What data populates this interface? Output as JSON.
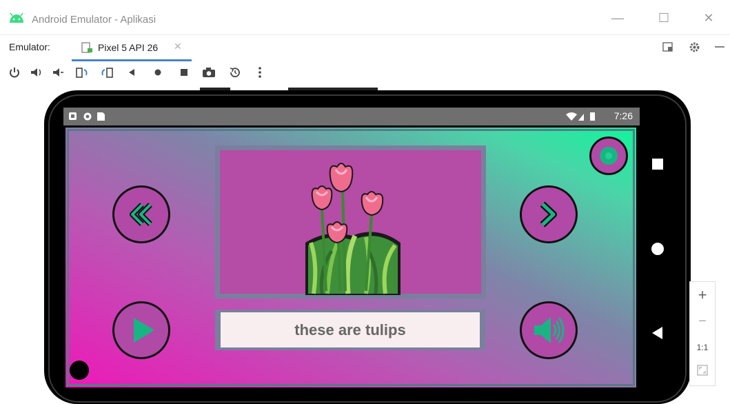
{
  "window": {
    "title": "Android Emulator - Aplikasi",
    "minimize": "—",
    "maximize": "☐",
    "close": "✕"
  },
  "tabs": {
    "label": "Emulator:",
    "device": "Pixel 5 API 26",
    "close": "✕"
  },
  "toolbar_icons": [
    "power-icon",
    "volume-up-icon",
    "volume-down-icon",
    "rotate-left-icon",
    "rotate-right-icon",
    "back-icon",
    "home-icon",
    "overview-icon",
    "screenshot-icon",
    "snapshot-icon",
    "more-icon"
  ],
  "device": {
    "status_time": "7:26"
  },
  "app": {
    "caption": "these are tulips",
    "colors": {
      "panel": "#b54ca6",
      "border": "#7a7f9e",
      "accent": "#18b583"
    }
  },
  "zoom": {
    "in": "+",
    "out": "−",
    "one_to_one": "1:1"
  }
}
